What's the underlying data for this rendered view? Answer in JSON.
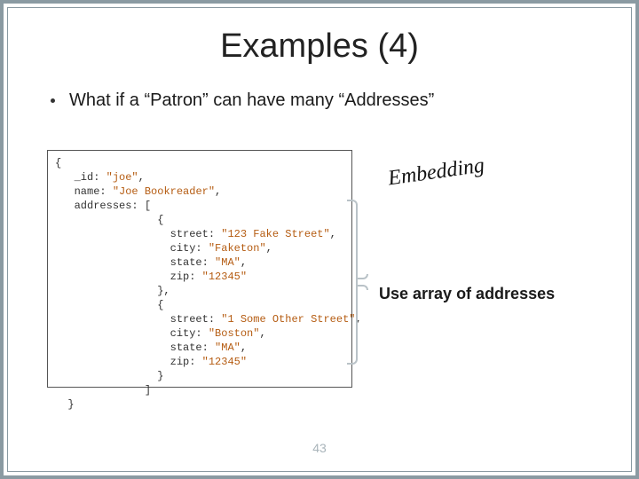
{
  "title": "Examples (4)",
  "bullet": "What if a “Patron” can have many “Addresses”",
  "embedding_label": "Embedding",
  "note_label": "Use array of addresses",
  "page_number": "43",
  "code": {
    "open": "{",
    "id_key": "_id:",
    "id_val": "\"joe\"",
    "name_key": "name:",
    "name_val": "\"Joe Bookreader\"",
    "addr_key": "addresses:",
    "addr_open": "[",
    "obj_open": "{",
    "obj_close_comma": "},",
    "obj_close": "}",
    "arr_close": "]",
    "close": "}",
    "comma": ",",
    "a1": {
      "street_key": "street:",
      "street_val": "\"123 Fake Street\"",
      "city_key": "city:",
      "city_val": "\"Faketon\"",
      "state_key": "state:",
      "state_val": "\"MA\"",
      "zip_key": "zip:",
      "zip_val": "\"12345\""
    },
    "a2": {
      "street_key": "street:",
      "street_val": "\"1 Some Other Street\"",
      "city_key": "city:",
      "city_val": "\"Boston\"",
      "state_key": "state:",
      "state_val": "\"MA\"",
      "zip_key": "zip:",
      "zip_val": "\"12345\""
    }
  }
}
